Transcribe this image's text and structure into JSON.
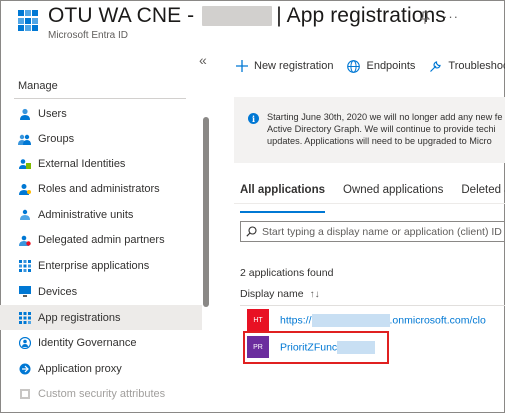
{
  "header": {
    "title_prefix": "OTU WA CNE -",
    "title_suffix": "| App registrations",
    "subtitle": "Microsoft Entra ID",
    "pin_icon": "pin-icon",
    "more_label": "···"
  },
  "sidebar": {
    "collapse_label": "«",
    "section_title": "Manage",
    "items": [
      {
        "label": "Users",
        "icon": "user-icon"
      },
      {
        "label": "Groups",
        "icon": "groups-icon"
      },
      {
        "label": "External Identities",
        "icon": "external-identities-icon"
      },
      {
        "label": "Roles and administrators",
        "icon": "roles-icon"
      },
      {
        "label": "Administrative units",
        "icon": "admin-units-icon"
      },
      {
        "label": "Delegated admin partners",
        "icon": "partners-icon"
      },
      {
        "label": "Enterprise applications",
        "icon": "enterprise-apps-icon"
      },
      {
        "label": "Devices",
        "icon": "devices-icon"
      },
      {
        "label": "App registrations",
        "icon": "app-registrations-icon",
        "active": true
      },
      {
        "label": "Identity Governance",
        "icon": "identity-governance-icon"
      },
      {
        "label": "Application proxy",
        "icon": "application-proxy-icon"
      },
      {
        "label": "Custom security attributes",
        "icon": "custom-security-icon",
        "disabled": true
      }
    ]
  },
  "toolbar": {
    "new_registration": "New registration",
    "endpoints": "Endpoints",
    "troubleshoot": "Troubleshoot"
  },
  "banner": {
    "line1": "Starting June 30th, 2020 we will no longer add any new fe",
    "line2": "Active Directory Graph. We will continue to provide techi",
    "line3": "updates. Applications will need to be upgraded to Micro"
  },
  "tabs": [
    {
      "label": "All applications",
      "active": true
    },
    {
      "label": "Owned applications"
    },
    {
      "label": "Deleted a"
    }
  ],
  "search": {
    "placeholder": "Start typing a display name or application (client) ID"
  },
  "list": {
    "count_text": "2 applications found",
    "column_display_name": "Display name",
    "sort_glyph": "↑↓",
    "rows": [
      {
        "badge": "HT",
        "badge_color": "#e81123",
        "name_prefix": "https://",
        "name_suffix": ".onmicrosoft.com/clo"
      },
      {
        "badge": "PR",
        "badge_color": "#6b2d9e",
        "name_prefix": "PrioritZFunc",
        "name_suffix": ""
      }
    ]
  },
  "colors": {
    "accent": "#0078d4",
    "highlight": "#e02020"
  }
}
